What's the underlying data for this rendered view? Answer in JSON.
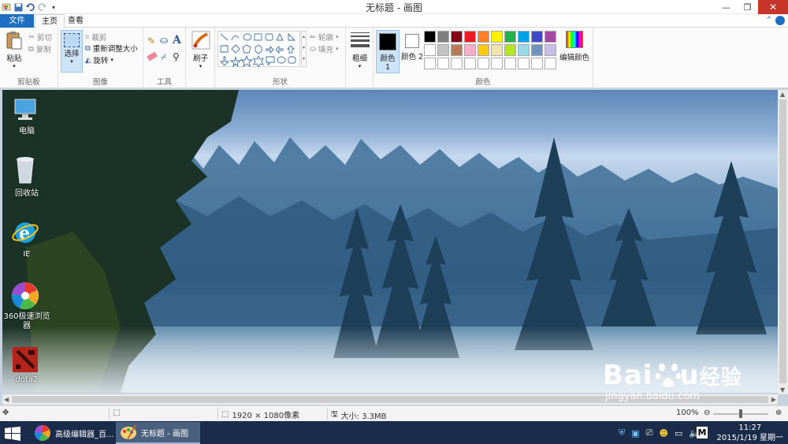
{
  "window": {
    "title": "无标题 - 画图"
  },
  "tabs": {
    "file": "文件",
    "home": "主页",
    "view": "查看"
  },
  "ribbon": {
    "clipboard": {
      "paste": "粘贴",
      "cut": "剪切",
      "copy": "复制",
      "label": "剪贴板"
    },
    "image": {
      "select": "选择",
      "crop": "裁剪",
      "resize": "重新调整大小",
      "rotate": "旋转",
      "label": "图像"
    },
    "tools": {
      "label": "工具"
    },
    "brushes": {
      "label": "刷子"
    },
    "shapes": {
      "outline": "轮廓",
      "fill": "填充",
      "label": "形状"
    },
    "size": {
      "label": "粗细"
    },
    "colors": {
      "color1": "颜色 1",
      "color2": "颜色 2",
      "edit": "编辑颜色",
      "label": "颜色",
      "color1_value": "#000000",
      "color2_value": "#ffffff",
      "palette_row1": [
        "#000000",
        "#7f7f7f",
        "#880015",
        "#ed1c24",
        "#ff7f27",
        "#fff200",
        "#22b14c",
        "#00a2e8",
        "#3f48cc",
        "#a349a4"
      ],
      "palette_row2": [
        "#ffffff",
        "#c3c3c3",
        "#b97a57",
        "#ffaec9",
        "#ffc90e",
        "#efe4b0",
        "#b5e61d",
        "#99d9ea",
        "#7092be",
        "#c8bfe7"
      ]
    }
  },
  "desktop_icons": [
    {
      "label": "电脑",
      "icon": "computer-icon"
    },
    {
      "label": "回收站",
      "icon": "recycle-bin-icon"
    },
    {
      "label": "IE",
      "icon": "ie-icon"
    },
    {
      "label": "360极速浏览器",
      "icon": "browser-360-icon"
    },
    {
      "label": "dota2",
      "icon": "dota2-icon"
    }
  ],
  "status": {
    "dimensions": "1920 × 1080像素",
    "size": "大小: 3.3MB",
    "zoom": "100%"
  },
  "taskbar": {
    "tasks": [
      {
        "label": "高级编辑器_百...",
        "active": false
      },
      {
        "label": "无标题 - 画图",
        "active": true
      }
    ],
    "ime": "M",
    "time": "11:27",
    "date": "2015/1/19 星期一"
  },
  "watermark": {
    "brand": "Bai",
    "brand2": "u",
    "cn": "经验",
    "url": "jingyan.baidu.com"
  }
}
